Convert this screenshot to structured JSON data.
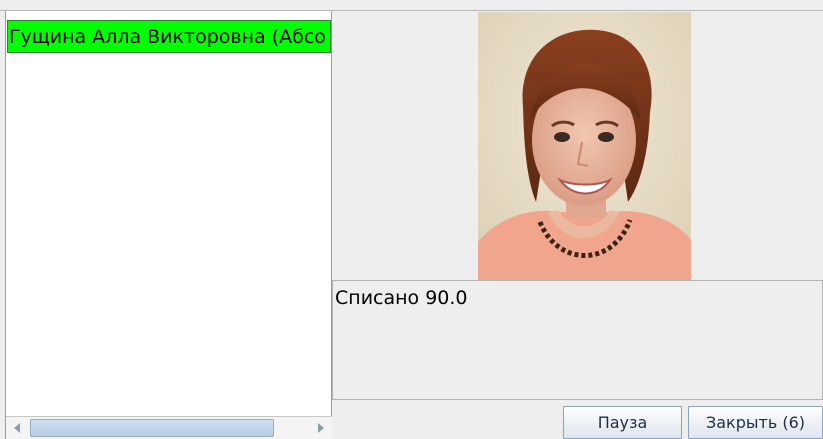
{
  "list": {
    "items": [
      {
        "label": "Гущина Алла Викторовна (Абсо",
        "selected": true,
        "highlight_color": "#00ff00"
      }
    ]
  },
  "message": {
    "text": "Списано 90.0"
  },
  "buttons": {
    "pause_label": "Пауза",
    "close_label": "Закрыть (6)"
  },
  "scrollbar": {
    "left_icon": "arrow-left-icon",
    "right_icon": "arrow-right-icon"
  }
}
